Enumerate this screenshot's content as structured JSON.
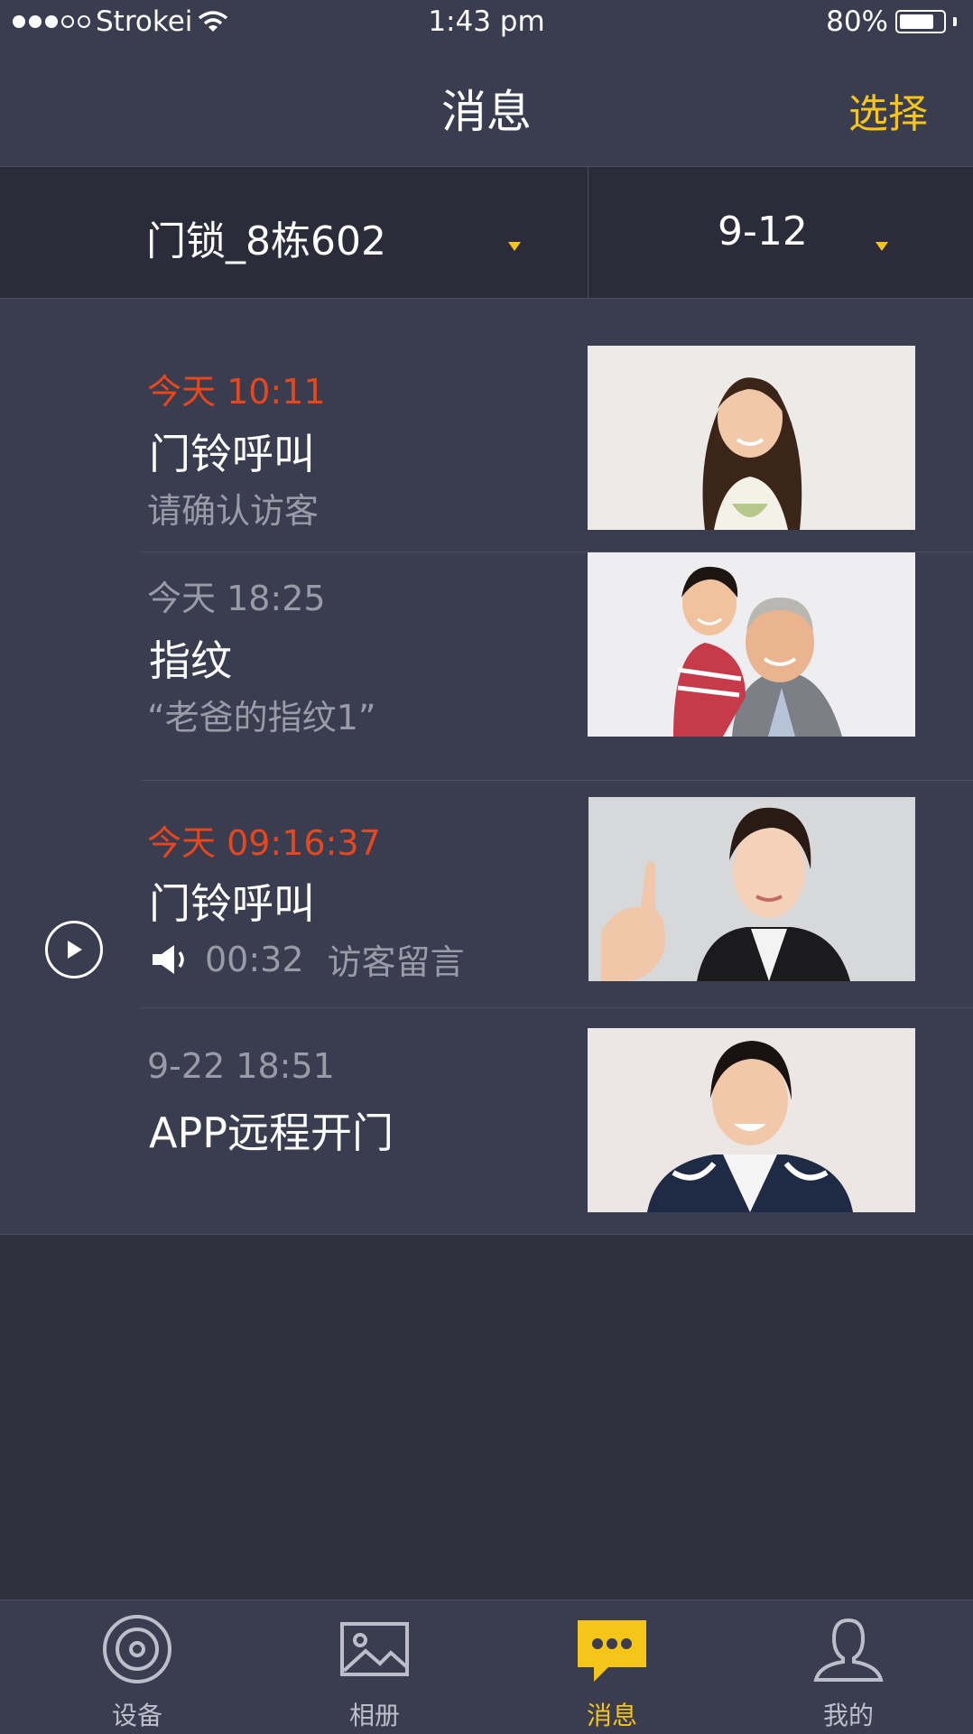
{
  "status_bar": {
    "carrier": "Strokei",
    "time": "1:43 pm",
    "battery": "80%",
    "battery_level": 0.8
  },
  "header": {
    "title": "消息",
    "select_label": "选择"
  },
  "filter": {
    "device": "门锁_8栋602",
    "date": "9-12"
  },
  "messages": [
    {
      "time": "今天  10:11",
      "title": "门铃呼叫",
      "subtitle": "请确认访客",
      "time_highlight": true,
      "photo": "woman-long-hair-photo"
    },
    {
      "time": "今天  18:25",
      "title": "指纹",
      "subtitle": "“老爸的指纹1”",
      "time_highlight": false,
      "photo": "grandfather-boy-photo"
    },
    {
      "time": "今天  09:16:37",
      "title": "门铃呼叫",
      "duration": "00:32",
      "note": "访客留言",
      "time_highlight": true,
      "photo": "woman-pointing-photo"
    },
    {
      "time": "9-22  18:51",
      "title": "APP远程开门",
      "time_highlight": false,
      "photo": "girl-smiling-photo"
    }
  ],
  "tabs": [
    {
      "label": "设备",
      "icon": "device-icon",
      "active": false
    },
    {
      "label": "相册",
      "icon": "album-icon",
      "active": false
    },
    {
      "label": "消息",
      "icon": "message-icon",
      "active": true
    },
    {
      "label": "我的",
      "icon": "profile-icon",
      "active": false
    }
  ],
  "colors": {
    "accent": "#f5c518",
    "alert": "#e8461c",
    "background": "#3a3c4f"
  }
}
